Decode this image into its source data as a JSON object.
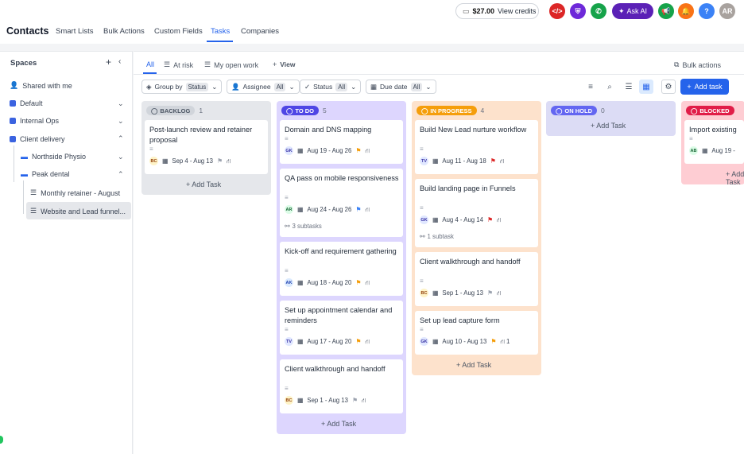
{
  "app": {
    "title": "Contacts"
  },
  "nav": {
    "tabs": [
      "Smart Lists",
      "Bulk Actions",
      "Custom Fields",
      "Tasks",
      "Companies"
    ]
  },
  "top": {
    "credits_amount": "$27.00",
    "credits_label": "View credits",
    "ask_ai": "Ask AI",
    "avatar": "AR",
    "help": "?"
  },
  "sidebar": {
    "title": "Spaces",
    "shared": "Shared with me",
    "items": [
      "Default",
      "Internal Ops",
      "Client delivery"
    ],
    "sub": [
      "Northside Physio",
      "Peak dental"
    ],
    "lists": [
      "Monthly retainer - August",
      "Website and Lead funnel..."
    ]
  },
  "views": {
    "tabs": [
      "All",
      "At risk",
      "My open work"
    ],
    "add": "View",
    "bulk": "Bulk actions"
  },
  "filters": {
    "group_label": "Group by",
    "group_val": "Status",
    "assignee": "Assignee",
    "assignee_val": "All",
    "status": "Status",
    "status_val": "All",
    "due": "Due date",
    "due_val": "All"
  },
  "add_task_btn": "Add task",
  "add_task_link": "+ Add Task",
  "columns": [
    {
      "name": "BACKLOG",
      "count": "1",
      "bg": "#e5e7eb",
      "badge": "#d1d5db",
      "fg": "#4b5563",
      "cards": [
        {
          "title": "Post-launch review and retainer proposal",
          "av": "BC",
          "date": "Sep 4 - Aug 13",
          "flag": "⚑"
        }
      ]
    },
    {
      "name": "TO DO",
      "count": "5",
      "bg": "#ddd6fe",
      "badge": "#4f46e5",
      "fg": "#fff",
      "cards": [
        {
          "title": "Domain and DNS mapping",
          "av": "GK",
          "date": "Aug 19 - Aug 26",
          "flag": "⚑"
        },
        {
          "title": "QA pass on mobile responsiveness",
          "av": "AR",
          "date": "Aug 24 - Aug 26",
          "flag": "⚑",
          "sub": "3 subtasks"
        },
        {
          "title": "Kick-off and requirement gathering",
          "av": "AK",
          "date": "Aug 18 - Aug 20",
          "flag": "⚑"
        },
        {
          "title": "Set up appointment calendar and reminders",
          "av": "TV",
          "date": "Aug 17 - Aug 20",
          "flag": "⚑"
        },
        {
          "title": "Client walkthrough and handoff",
          "av": "BC",
          "date": "Sep 1 - Aug 13",
          "flag": "⚑"
        }
      ]
    },
    {
      "name": "IN PROGRESS",
      "count": "4",
      "bg": "#fde2cc",
      "badge": "#f59e0b",
      "fg": "#fff",
      "cards": [
        {
          "title": "Build New Lead nurture workflow",
          "av": "TV",
          "date": "Aug 11 - Aug 18",
          "flag": "⚑"
        },
        {
          "title": "Build landing page in Funnels",
          "av": "GK",
          "date": "Aug 4 - Aug 14",
          "flag": "⚑",
          "sub": "1 subtask"
        },
        {
          "title": "Client walkthrough and handoff",
          "av": "BC",
          "date": "Sep 1 - Aug 13",
          "flag": "⚑"
        },
        {
          "title": "Set up lead capture form",
          "av": "GK",
          "date": "Aug 10 - Aug 13",
          "flag": "⚑",
          "deps": "1"
        }
      ]
    },
    {
      "name": "ON HOLD",
      "count": "0",
      "bg": "#dcdcf5",
      "badge": "#6366f1",
      "fg": "#fff",
      "cards": []
    },
    {
      "name": "BLOCKED",
      "count": "",
      "bg": "#fecdd3",
      "badge": "#e11d48",
      "fg": "#fff",
      "cards": [
        {
          "title": "Import existing",
          "av": "AB",
          "date": "Aug 19 -",
          "flag": ""
        }
      ]
    }
  ]
}
